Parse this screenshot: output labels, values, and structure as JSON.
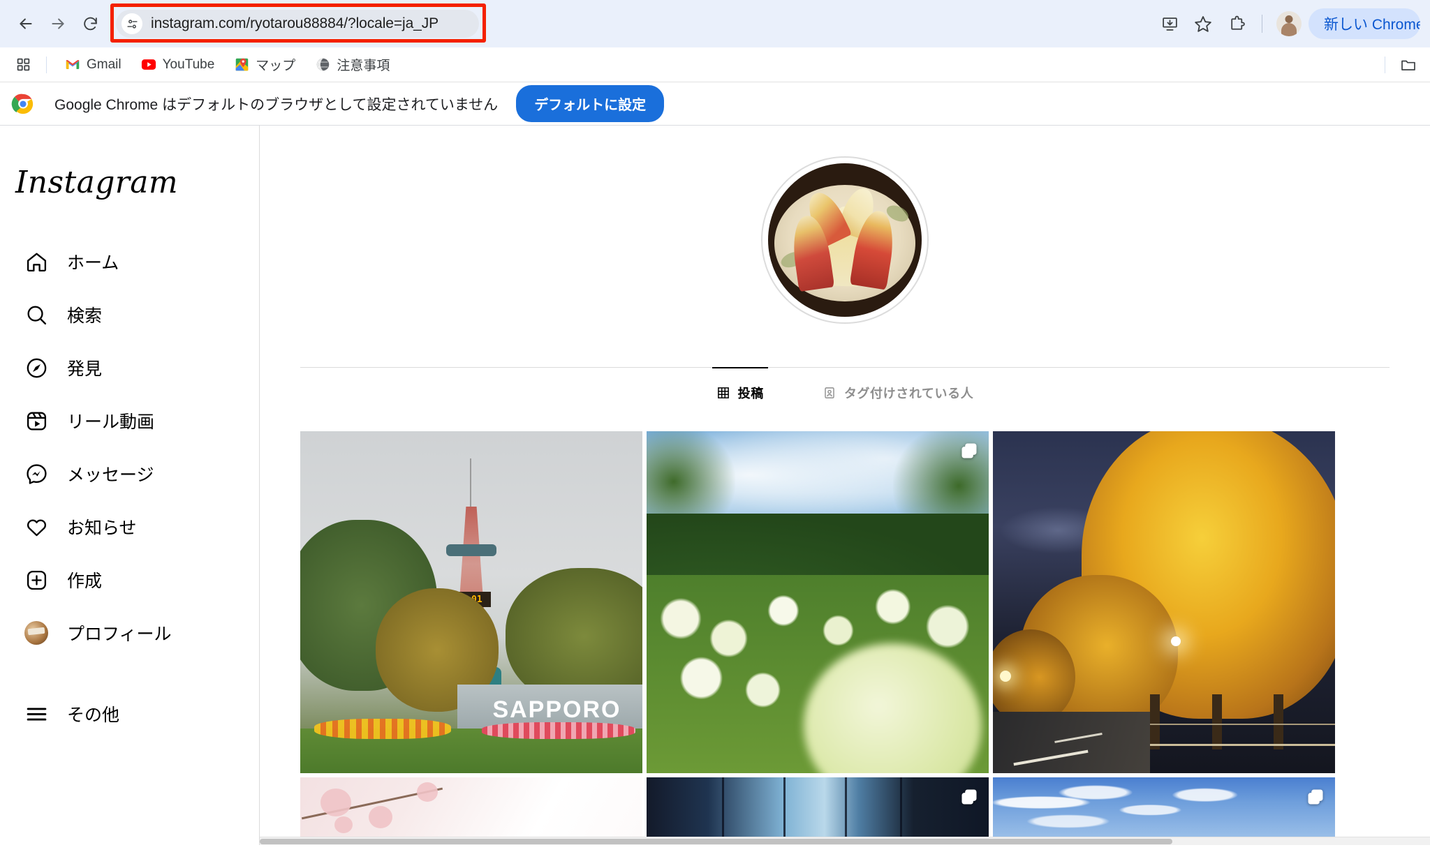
{
  "browser": {
    "nav": {
      "back_label": "戻る",
      "forward_label": "進む",
      "reload_label": "再読み込み"
    },
    "omnibox": {
      "url": "instagram.com/ryotarou88884/?locale=ja_JP",
      "site_info_icon": "site-settings-icon",
      "highlight_color": "#f42100"
    },
    "toolbar_right": {
      "install_label": "インストール",
      "bookmark_label": "ブックマーク",
      "extensions_label": "拡張機能",
      "profile_label": "プロフィール",
      "promo_label": "新しい Chrome をご利"
    },
    "bookmarks": {
      "apps_label": "アプリ",
      "items": [
        {
          "label": "Gmail",
          "icon": "gmail-icon"
        },
        {
          "label": "YouTube",
          "icon": "youtube-icon"
        },
        {
          "label": "マップ",
          "icon": "google-maps-icon"
        },
        {
          "label": "注意事項",
          "icon": "globe-icon"
        }
      ],
      "folder_label": "その他のブックマーク"
    },
    "default_banner": {
      "icon": "chrome-logo-icon",
      "message": "Google Chrome はデフォルトのブラウザとして設定されていません",
      "button_label": "デフォルトに設定",
      "button_color": "#1a6fdb"
    }
  },
  "instagram": {
    "logo_text": "Instagram",
    "nav_items": [
      {
        "label": "ホーム",
        "icon": "home-icon"
      },
      {
        "label": "検索",
        "icon": "search-icon"
      },
      {
        "label": "発見",
        "icon": "compass-icon"
      },
      {
        "label": "リール動画",
        "icon": "reels-icon"
      },
      {
        "label": "メッセージ",
        "icon": "messenger-icon"
      },
      {
        "label": "お知らせ",
        "icon": "heart-icon"
      },
      {
        "label": "作成",
        "icon": "plus-square-icon"
      },
      {
        "label": "プロフィール",
        "icon": "avatar-icon"
      }
    ],
    "more_item": {
      "label": "その他",
      "icon": "hamburger-icon"
    },
    "profile": {
      "avatar_alt": "りんごのうさぎ切りが皿に盛られたプロフィール写真"
    },
    "tabs": [
      {
        "label": "投稿",
        "icon": "grid-icon",
        "active": true
      },
      {
        "label": "タグ付けされている人",
        "icon": "tag-person-icon",
        "active": false
      }
    ],
    "posts": [
      {
        "alt": "さっぽろテレビ塔とSAPPOROサイン",
        "sign_text": "SAPPORO",
        "clock_text": "4:01",
        "carousel": false
      },
      {
        "alt": "白いアジサイ畑と青空",
        "carousel": true
      },
      {
        "alt": "夜のライトアップされた黄色いイチョウ並木",
        "carousel": false
      },
      {
        "alt": "桜の花のクローズアップ",
        "carousel": false
      },
      {
        "alt": "青いガラス張りのビル",
        "carousel": true
      },
      {
        "alt": "うろこ雲の青空",
        "carousel": true
      }
    ]
  }
}
